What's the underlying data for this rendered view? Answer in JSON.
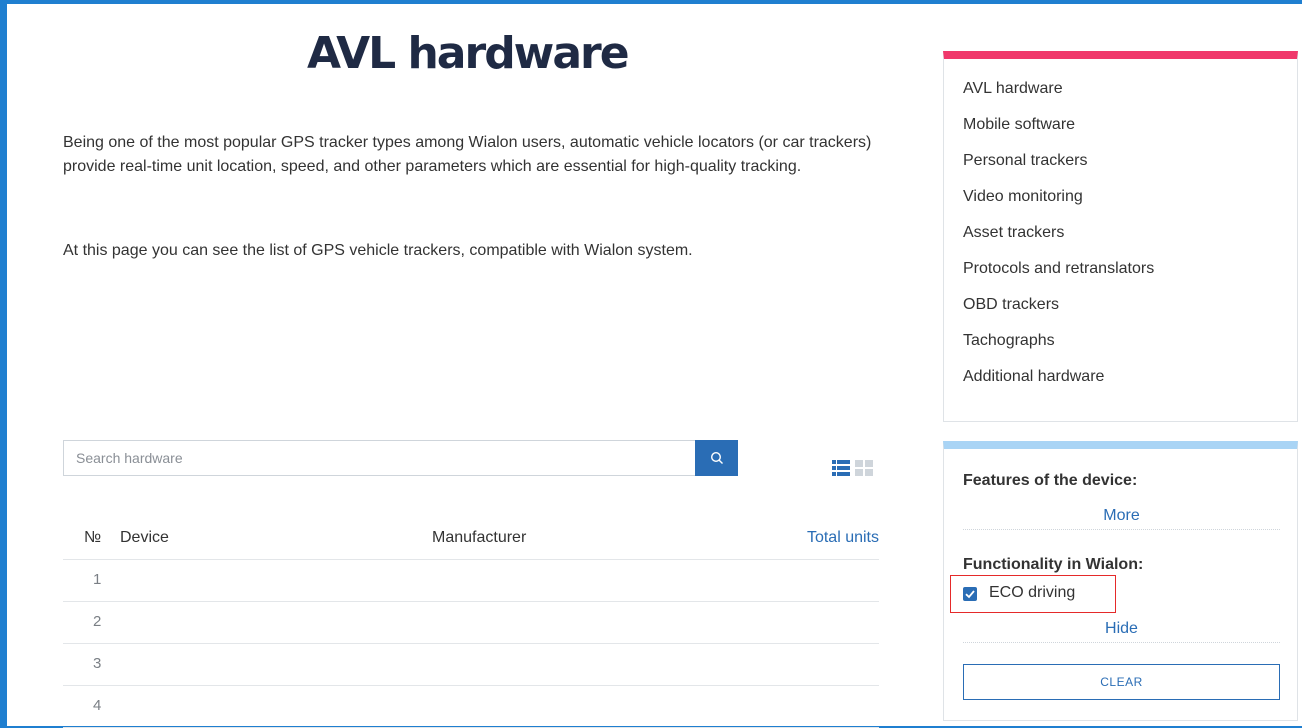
{
  "page": {
    "title": "AVL hardware",
    "paragraph1": "Being one of the most popular GPS tracker types among Wialon users, automatic vehicle locators (or car trackers) provide real-time unit location, speed, and other parameters which are essential for high-quality tracking.",
    "paragraph2": "At this page you can see the list of GPS vehicle trackers, compatible with Wialon system."
  },
  "search": {
    "placeholder": "Search hardware",
    "icon": "search-icon"
  },
  "view_toggle": {
    "list_icon": "list-view-icon",
    "grid_icon": "grid-view-icon"
  },
  "table": {
    "headers": {
      "num": "№",
      "device": "Device",
      "manufacturer": "Manufacturer",
      "total": "Total units"
    },
    "rows": [
      {
        "num": "1"
      },
      {
        "num": "2"
      },
      {
        "num": "3"
      },
      {
        "num": "4"
      }
    ]
  },
  "sidebar": {
    "menu": [
      {
        "label": "AVL hardware"
      },
      {
        "label": "Mobile software"
      },
      {
        "label": "Personal trackers"
      },
      {
        "label": "Video monitoring"
      },
      {
        "label": "Asset trackers"
      },
      {
        "label": "Protocols and retranslators"
      },
      {
        "label": "OBD trackers"
      },
      {
        "label": "Tachographs"
      },
      {
        "label": "Additional hardware"
      }
    ],
    "filters": {
      "features_label": "Features of the device:",
      "more_link": "More",
      "functionality_label": "Functionality in Wialon:",
      "eco_label": "ECO driving",
      "eco_checked": true,
      "hide_link": "Hide",
      "clear_label": "CLEAR"
    }
  },
  "colors": {
    "accent_blue": "#2a6db5",
    "menu_top_bar": "#f0386b",
    "filter_top_bar": "#a9d4f5",
    "highlight_red": "#e52a2a",
    "page_frame": "#1f7fd0"
  }
}
